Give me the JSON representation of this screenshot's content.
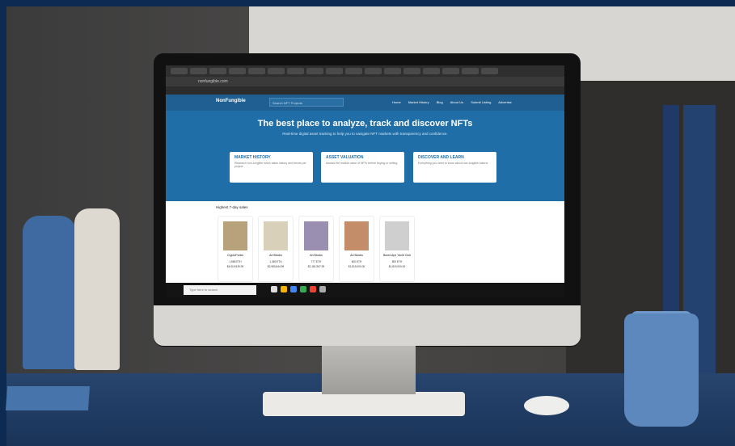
{
  "website": {
    "logo_text": "NonFungible",
    "search_placeholder": "Search NFT Projects",
    "menu": [
      "Home",
      "Market History",
      "Blog",
      "About Us",
      "Submit Listing",
      "Advertise"
    ],
    "hero_title": "The best place to analyze, track and discover NFTs",
    "hero_subtitle": "Real-time digital asset tracking to help you to navigate NFT markets with transparency and confidence.",
    "cards": [
      {
        "title": "MARKET HISTORY",
        "text": "Research non-fungible token sales history and trends per project"
      },
      {
        "title": "ASSET VALUATION",
        "text": "Assess the market value of NFTs before buying or selling"
      },
      {
        "title": "DISCOVER AND LEARN",
        "text": "Everything you need to know about non-fungible tokens"
      }
    ],
    "section_title": "Highest 7-day sales",
    "nfts": [
      {
        "name": "CryptoPunks",
        "value1": "1,568 ETH",
        "value2": "$4,919,539.39"
      },
      {
        "name": "Art Blocks",
        "value1": "1,369 ETH",
        "value2": "$2,983,644.99"
      },
      {
        "name": "Art Blocks",
        "value1": "777 ETH",
        "value2": "$2,181,957.99"
      },
      {
        "name": "Art Blocks",
        "value1": "600 ETH",
        "value2": "$1,819,000.00"
      },
      {
        "name": "Bored Ape Yacht Club",
        "value1": "800 ETH",
        "value2": "$1,819,000.00"
      }
    ],
    "address_bar": "nonfungible.com",
    "taskbar_search": "Type here to search"
  }
}
